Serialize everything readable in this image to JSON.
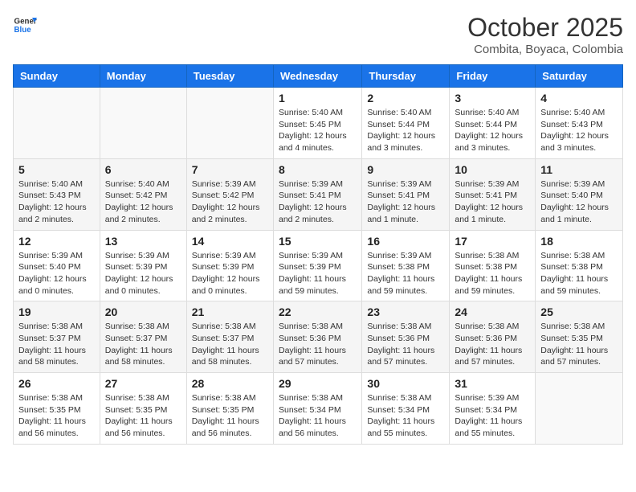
{
  "header": {
    "logo_general": "General",
    "logo_blue": "Blue",
    "month_year": "October 2025",
    "location": "Combita, Boyaca, Colombia"
  },
  "weekdays": [
    "Sunday",
    "Monday",
    "Tuesday",
    "Wednesday",
    "Thursday",
    "Friday",
    "Saturday"
  ],
  "weeks": [
    [
      {
        "day": "",
        "info": ""
      },
      {
        "day": "",
        "info": ""
      },
      {
        "day": "",
        "info": ""
      },
      {
        "day": "1",
        "info": "Sunrise: 5:40 AM\nSunset: 5:45 PM\nDaylight: 12 hours\nand 4 minutes."
      },
      {
        "day": "2",
        "info": "Sunrise: 5:40 AM\nSunset: 5:44 PM\nDaylight: 12 hours\nand 3 minutes."
      },
      {
        "day": "3",
        "info": "Sunrise: 5:40 AM\nSunset: 5:44 PM\nDaylight: 12 hours\nand 3 minutes."
      },
      {
        "day": "4",
        "info": "Sunrise: 5:40 AM\nSunset: 5:43 PM\nDaylight: 12 hours\nand 3 minutes."
      }
    ],
    [
      {
        "day": "5",
        "info": "Sunrise: 5:40 AM\nSunset: 5:43 PM\nDaylight: 12 hours\nand 2 minutes."
      },
      {
        "day": "6",
        "info": "Sunrise: 5:40 AM\nSunset: 5:42 PM\nDaylight: 12 hours\nand 2 minutes."
      },
      {
        "day": "7",
        "info": "Sunrise: 5:39 AM\nSunset: 5:42 PM\nDaylight: 12 hours\nand 2 minutes."
      },
      {
        "day": "8",
        "info": "Sunrise: 5:39 AM\nSunset: 5:41 PM\nDaylight: 12 hours\nand 2 minutes."
      },
      {
        "day": "9",
        "info": "Sunrise: 5:39 AM\nSunset: 5:41 PM\nDaylight: 12 hours\nand 1 minute."
      },
      {
        "day": "10",
        "info": "Sunrise: 5:39 AM\nSunset: 5:41 PM\nDaylight: 12 hours\nand 1 minute."
      },
      {
        "day": "11",
        "info": "Sunrise: 5:39 AM\nSunset: 5:40 PM\nDaylight: 12 hours\nand 1 minute."
      }
    ],
    [
      {
        "day": "12",
        "info": "Sunrise: 5:39 AM\nSunset: 5:40 PM\nDaylight: 12 hours\nand 0 minutes."
      },
      {
        "day": "13",
        "info": "Sunrise: 5:39 AM\nSunset: 5:39 PM\nDaylight: 12 hours\nand 0 minutes."
      },
      {
        "day": "14",
        "info": "Sunrise: 5:39 AM\nSunset: 5:39 PM\nDaylight: 12 hours\nand 0 minutes."
      },
      {
        "day": "15",
        "info": "Sunrise: 5:39 AM\nSunset: 5:39 PM\nDaylight: 11 hours\nand 59 minutes."
      },
      {
        "day": "16",
        "info": "Sunrise: 5:39 AM\nSunset: 5:38 PM\nDaylight: 11 hours\nand 59 minutes."
      },
      {
        "day": "17",
        "info": "Sunrise: 5:38 AM\nSunset: 5:38 PM\nDaylight: 11 hours\nand 59 minutes."
      },
      {
        "day": "18",
        "info": "Sunrise: 5:38 AM\nSunset: 5:38 PM\nDaylight: 11 hours\nand 59 minutes."
      }
    ],
    [
      {
        "day": "19",
        "info": "Sunrise: 5:38 AM\nSunset: 5:37 PM\nDaylight: 11 hours\nand 58 minutes."
      },
      {
        "day": "20",
        "info": "Sunrise: 5:38 AM\nSunset: 5:37 PM\nDaylight: 11 hours\nand 58 minutes."
      },
      {
        "day": "21",
        "info": "Sunrise: 5:38 AM\nSunset: 5:37 PM\nDaylight: 11 hours\nand 58 minutes."
      },
      {
        "day": "22",
        "info": "Sunrise: 5:38 AM\nSunset: 5:36 PM\nDaylight: 11 hours\nand 57 minutes."
      },
      {
        "day": "23",
        "info": "Sunrise: 5:38 AM\nSunset: 5:36 PM\nDaylight: 11 hours\nand 57 minutes."
      },
      {
        "day": "24",
        "info": "Sunrise: 5:38 AM\nSunset: 5:36 PM\nDaylight: 11 hours\nand 57 minutes."
      },
      {
        "day": "25",
        "info": "Sunrise: 5:38 AM\nSunset: 5:35 PM\nDaylight: 11 hours\nand 57 minutes."
      }
    ],
    [
      {
        "day": "26",
        "info": "Sunrise: 5:38 AM\nSunset: 5:35 PM\nDaylight: 11 hours\nand 56 minutes."
      },
      {
        "day": "27",
        "info": "Sunrise: 5:38 AM\nSunset: 5:35 PM\nDaylight: 11 hours\nand 56 minutes."
      },
      {
        "day": "28",
        "info": "Sunrise: 5:38 AM\nSunset: 5:35 PM\nDaylight: 11 hours\nand 56 minutes."
      },
      {
        "day": "29",
        "info": "Sunrise: 5:38 AM\nSunset: 5:34 PM\nDaylight: 11 hours\nand 56 minutes."
      },
      {
        "day": "30",
        "info": "Sunrise: 5:38 AM\nSunset: 5:34 PM\nDaylight: 11 hours\nand 55 minutes."
      },
      {
        "day": "31",
        "info": "Sunrise: 5:39 AM\nSunset: 5:34 PM\nDaylight: 11 hours\nand 55 minutes."
      },
      {
        "day": "",
        "info": ""
      }
    ]
  ]
}
